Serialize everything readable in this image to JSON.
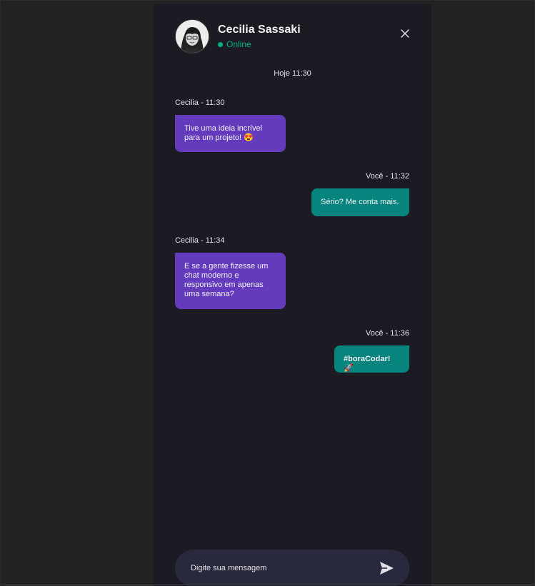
{
  "contact": {
    "name": "Cecilia Sassaki",
    "status": "Online"
  },
  "date_divider": "Hoje 11:30",
  "messages": [
    {
      "meta": "Cecilia - 11:30",
      "text": "Tive uma ideia incrível para um projeto! 😍",
      "direction": "in"
    },
    {
      "meta": "Você - 11:32",
      "text": "Sério? Me conta mais.",
      "direction": "out"
    },
    {
      "meta": "Cecilia - 11:34",
      "text": "E se a gente fizesse um chat moderno e responsivo em apenas uma semana?",
      "direction": "in"
    },
    {
      "meta": "Você - 11:36",
      "text": "#boraCodar! 🚀",
      "direction": "out"
    }
  ],
  "composer": {
    "placeholder": "Digite sua mensagem",
    "value": ""
  },
  "icons": {
    "close": "close-icon",
    "send": "send-icon",
    "avatar": "avatar"
  },
  "colors": {
    "incoming_bubble": "#633bbc",
    "outgoing_bubble": "#07847e",
    "online": "#00b37e",
    "panel": "#1c1b24",
    "composer": "#29293e"
  }
}
